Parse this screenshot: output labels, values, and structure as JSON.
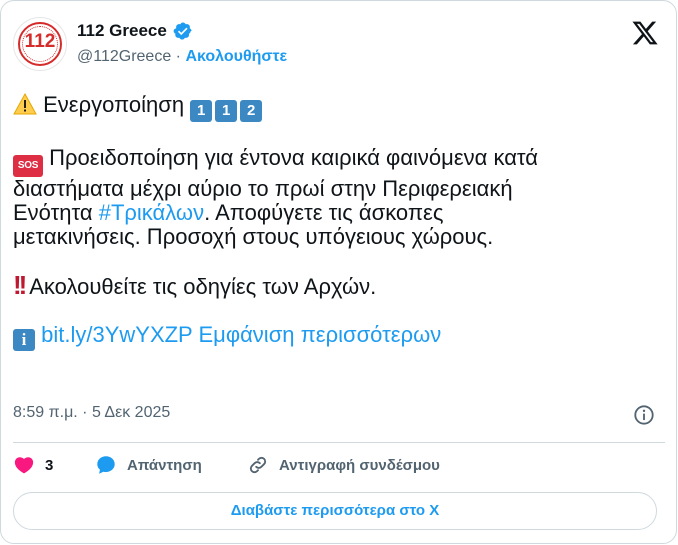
{
  "header": {
    "avatar_text": "112",
    "account_name": "112 Greece",
    "handle": "@112Greece",
    "separator": "·",
    "follow_label": "Ακολουθήστε"
  },
  "tweet": {
    "line1": "Ενεργοποίηση",
    "keycaps": [
      "1",
      "1",
      "2"
    ],
    "sos_label": "SOS",
    "para2_line1": "Προειδοποίηση για έντονα καιρικά φαινόμενα κατά",
    "para2_line2": "διαστήματα μέχρι αύριο το πρωί στην Περιφερειακή",
    "para2_line3_before": "Ενότητα ",
    "hashtag": "#Τρικάλων",
    "para2_line3_after": ". Αποφύγετε τις άσκοπες",
    "para2_line4": "μετακινήσεις. Προσοχή στους υπόγειους χώρους.",
    "bang": "!!",
    "para3": "Ακολουθείτε τις οδηγίες των Αρχών.",
    "info_label": "i",
    "link": "bit.ly/3YwYXZP",
    "show_more": "Εμφάνιση περισσότερων"
  },
  "timestamp": "8:59 π.μ. · 5 Δεκ 2025",
  "actions": {
    "like_count": "3",
    "reply_label": "Απάντηση",
    "copy_link_label": "Αντιγραφή συνδέσμου"
  },
  "read_more_label": "Διαβάστε περισσότερα στο X",
  "colors": {
    "accent": "#1d9bf0",
    "like": "#f91880",
    "text": "#0f1419",
    "muted": "#536471",
    "border": "#cfd9de"
  }
}
